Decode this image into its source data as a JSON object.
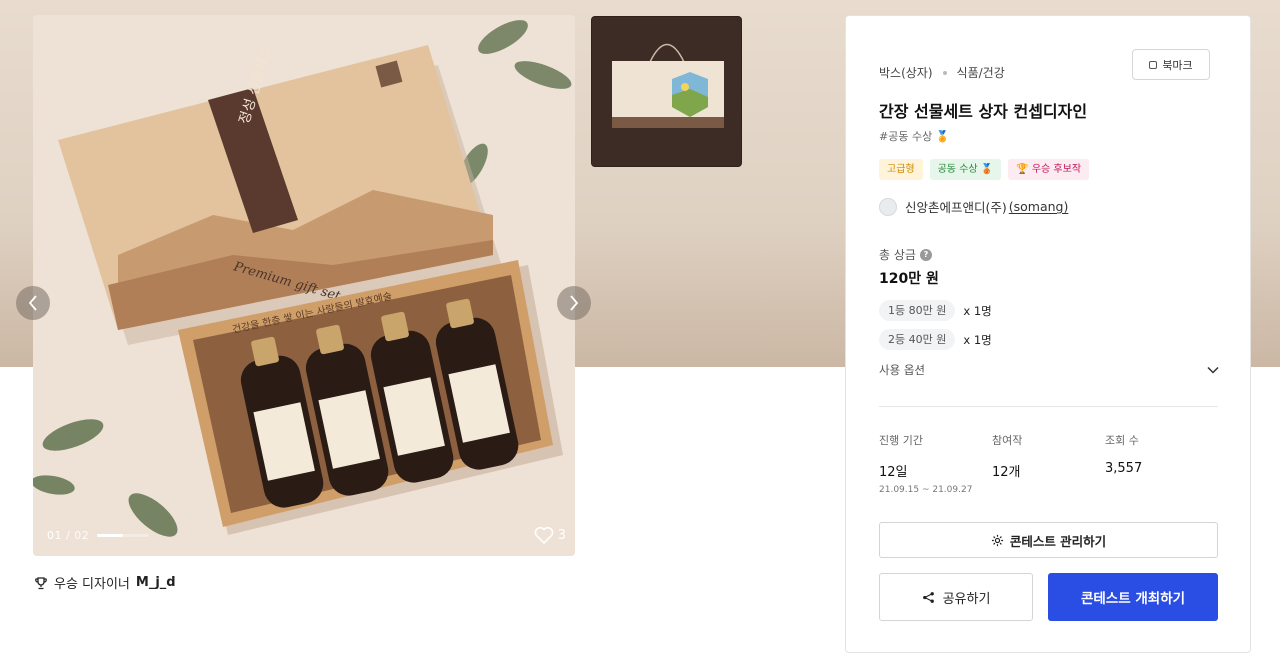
{
  "gallery": {
    "current_index": "01",
    "separator": "/",
    "total": "02",
    "like_count": "3",
    "slide_progress": 0.5,
    "box_lid_title": "정성 선물세트",
    "box_lid_script": "Premium gift set",
    "tray_text": "건강을 한층 쌓 이는 사랑들의 발효예술",
    "bottle_label": "생명물 간장"
  },
  "winner": {
    "prefix": "우승 디자이너",
    "name": "M_j_d"
  },
  "panel": {
    "category": "박스(상자)",
    "subcategory": "식품/건강",
    "bookmark_label": "북마크",
    "title": "간장 선물세트 상자 컨셉디자인",
    "hashtag": "#공동 수상 🏅",
    "badges": [
      {
        "label": "고급형"
      },
      {
        "label": "공동 수상 🥉"
      },
      {
        "label": "🏆 우승 후보작"
      }
    ],
    "company_name": "신앙촌에프앤디(주)",
    "company_handle": "(somang)",
    "prize_label": "총 상금",
    "prize_help": "?",
    "prize_total": "120만 원",
    "prize_rows": [
      {
        "tier": "1등 80만 원",
        "count": "x 1명"
      },
      {
        "tier": "2등 40만 원",
        "count": "x 1명"
      }
    ],
    "options_label": "사용 옵션",
    "stats": [
      {
        "label": "진행 기간",
        "value": "12일",
        "sub": "21.09.15 ~ 21.09.27"
      },
      {
        "label": "참여작",
        "value": "12개",
        "sub": ""
      },
      {
        "label": "조회 수",
        "value": "3,557",
        "sub": ""
      }
    ],
    "manage_label": "콘테스트 관리하기",
    "share_label": "공유하기",
    "host_label": "콘테스트 개최하기"
  },
  "colors": {
    "primary": "#2a4de3",
    "hero_bg": "#e0d3c4"
  }
}
